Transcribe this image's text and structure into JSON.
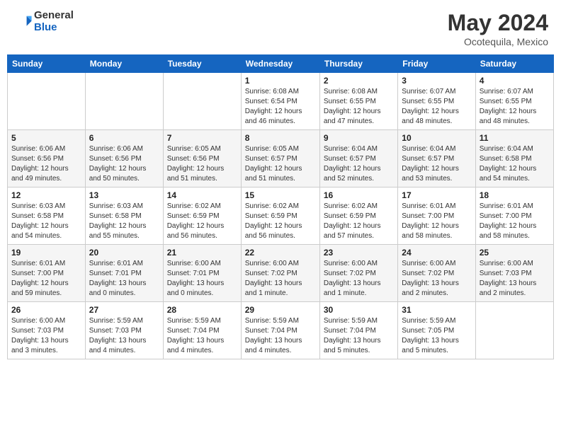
{
  "header": {
    "logo_general": "General",
    "logo_blue": "Blue",
    "title": "May 2024",
    "location": "Ocotequila, Mexico"
  },
  "days_of_week": [
    "Sunday",
    "Monday",
    "Tuesday",
    "Wednesday",
    "Thursday",
    "Friday",
    "Saturday"
  ],
  "weeks": [
    [
      {
        "day": "",
        "info": ""
      },
      {
        "day": "",
        "info": ""
      },
      {
        "day": "",
        "info": ""
      },
      {
        "day": "1",
        "info": "Sunrise: 6:08 AM\nSunset: 6:54 PM\nDaylight: 12 hours\nand 46 minutes."
      },
      {
        "day": "2",
        "info": "Sunrise: 6:08 AM\nSunset: 6:55 PM\nDaylight: 12 hours\nand 47 minutes."
      },
      {
        "day": "3",
        "info": "Sunrise: 6:07 AM\nSunset: 6:55 PM\nDaylight: 12 hours\nand 48 minutes."
      },
      {
        "day": "4",
        "info": "Sunrise: 6:07 AM\nSunset: 6:55 PM\nDaylight: 12 hours\nand 48 minutes."
      }
    ],
    [
      {
        "day": "5",
        "info": "Sunrise: 6:06 AM\nSunset: 6:56 PM\nDaylight: 12 hours\nand 49 minutes."
      },
      {
        "day": "6",
        "info": "Sunrise: 6:06 AM\nSunset: 6:56 PM\nDaylight: 12 hours\nand 50 minutes."
      },
      {
        "day": "7",
        "info": "Sunrise: 6:05 AM\nSunset: 6:56 PM\nDaylight: 12 hours\nand 51 minutes."
      },
      {
        "day": "8",
        "info": "Sunrise: 6:05 AM\nSunset: 6:57 PM\nDaylight: 12 hours\nand 51 minutes."
      },
      {
        "day": "9",
        "info": "Sunrise: 6:04 AM\nSunset: 6:57 PM\nDaylight: 12 hours\nand 52 minutes."
      },
      {
        "day": "10",
        "info": "Sunrise: 6:04 AM\nSunset: 6:57 PM\nDaylight: 12 hours\nand 53 minutes."
      },
      {
        "day": "11",
        "info": "Sunrise: 6:04 AM\nSunset: 6:58 PM\nDaylight: 12 hours\nand 54 minutes."
      }
    ],
    [
      {
        "day": "12",
        "info": "Sunrise: 6:03 AM\nSunset: 6:58 PM\nDaylight: 12 hours\nand 54 minutes."
      },
      {
        "day": "13",
        "info": "Sunrise: 6:03 AM\nSunset: 6:58 PM\nDaylight: 12 hours\nand 55 minutes."
      },
      {
        "day": "14",
        "info": "Sunrise: 6:02 AM\nSunset: 6:59 PM\nDaylight: 12 hours\nand 56 minutes."
      },
      {
        "day": "15",
        "info": "Sunrise: 6:02 AM\nSunset: 6:59 PM\nDaylight: 12 hours\nand 56 minutes."
      },
      {
        "day": "16",
        "info": "Sunrise: 6:02 AM\nSunset: 6:59 PM\nDaylight: 12 hours\nand 57 minutes."
      },
      {
        "day": "17",
        "info": "Sunrise: 6:01 AM\nSunset: 7:00 PM\nDaylight: 12 hours\nand 58 minutes."
      },
      {
        "day": "18",
        "info": "Sunrise: 6:01 AM\nSunset: 7:00 PM\nDaylight: 12 hours\nand 58 minutes."
      }
    ],
    [
      {
        "day": "19",
        "info": "Sunrise: 6:01 AM\nSunset: 7:00 PM\nDaylight: 12 hours\nand 59 minutes."
      },
      {
        "day": "20",
        "info": "Sunrise: 6:01 AM\nSunset: 7:01 PM\nDaylight: 13 hours\nand 0 minutes."
      },
      {
        "day": "21",
        "info": "Sunrise: 6:00 AM\nSunset: 7:01 PM\nDaylight: 13 hours\nand 0 minutes."
      },
      {
        "day": "22",
        "info": "Sunrise: 6:00 AM\nSunset: 7:02 PM\nDaylight: 13 hours\nand 1 minute."
      },
      {
        "day": "23",
        "info": "Sunrise: 6:00 AM\nSunset: 7:02 PM\nDaylight: 13 hours\nand 1 minute."
      },
      {
        "day": "24",
        "info": "Sunrise: 6:00 AM\nSunset: 7:02 PM\nDaylight: 13 hours\nand 2 minutes."
      },
      {
        "day": "25",
        "info": "Sunrise: 6:00 AM\nSunset: 7:03 PM\nDaylight: 13 hours\nand 2 minutes."
      }
    ],
    [
      {
        "day": "26",
        "info": "Sunrise: 6:00 AM\nSunset: 7:03 PM\nDaylight: 13 hours\nand 3 minutes."
      },
      {
        "day": "27",
        "info": "Sunrise: 5:59 AM\nSunset: 7:03 PM\nDaylight: 13 hours\nand 4 minutes."
      },
      {
        "day": "28",
        "info": "Sunrise: 5:59 AM\nSunset: 7:04 PM\nDaylight: 13 hours\nand 4 minutes."
      },
      {
        "day": "29",
        "info": "Sunrise: 5:59 AM\nSunset: 7:04 PM\nDaylight: 13 hours\nand 4 minutes."
      },
      {
        "day": "30",
        "info": "Sunrise: 5:59 AM\nSunset: 7:04 PM\nDaylight: 13 hours\nand 5 minutes."
      },
      {
        "day": "31",
        "info": "Sunrise: 5:59 AM\nSunset: 7:05 PM\nDaylight: 13 hours\nand 5 minutes."
      },
      {
        "day": "",
        "info": ""
      }
    ]
  ]
}
